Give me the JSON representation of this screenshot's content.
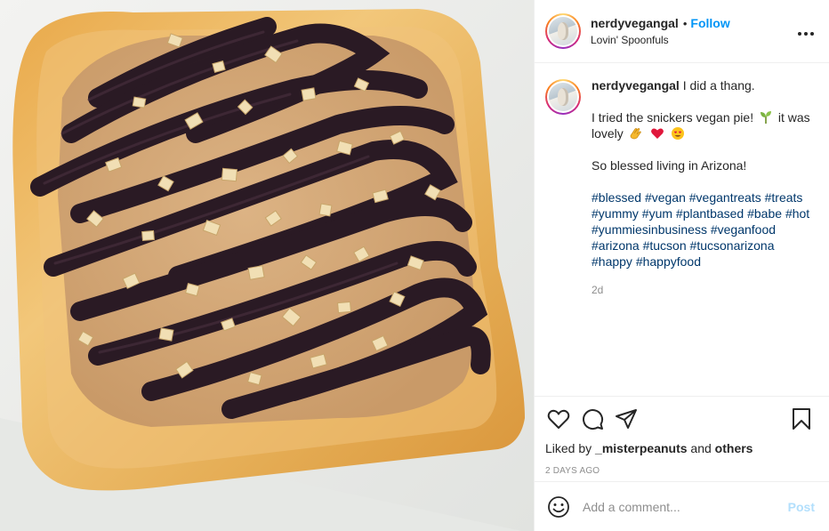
{
  "post": {
    "author": {
      "username": "nerdyvegangal",
      "follow_label": "Follow",
      "separator": "•",
      "location": "Lovin' Spoonfuls"
    },
    "more_icon": "more-options-icon",
    "caption": {
      "username": "nerdyvegangal",
      "first_line": "I did a thang.",
      "second_paragraph": "I tried the snickers vegan pie!",
      "second_paragraph_end": "it was lovely",
      "emojis": [
        "sprout-emoji",
        "clapping-hands-emoji",
        "red-heart-emoji",
        "smiling-face-with-heart-eyes-emoji"
      ],
      "third_paragraph": "So blessed living in Arizona!",
      "hashtags": [
        "#blessed",
        "#vegan",
        "#vegantreats",
        "#treats",
        "#yummy",
        "#yum",
        "#plantbased",
        "#babe",
        "#hot",
        "#yummiesinbusiness",
        "#veganfood",
        "#arizona",
        "#tucson",
        "#tucsonarizona",
        "#happy",
        "#happyfood"
      ],
      "age": "2d"
    },
    "actions": {
      "icons": [
        "heart-icon",
        "comment-icon",
        "share-icon",
        "bookmark-icon"
      ]
    },
    "likes": {
      "prefix": "Liked by",
      "user": "_misterpeanuts",
      "conjunction": "and",
      "others": "others"
    },
    "timestamp": "2 DAYS AGO",
    "comment": {
      "placeholder": "Add a comment...",
      "post_label": "Post"
    },
    "colors": {
      "follow": "#0095f6",
      "hashtag": "#00376b",
      "post_disabled": "#b2dffc",
      "muted": "#8e8e8e"
    }
  }
}
